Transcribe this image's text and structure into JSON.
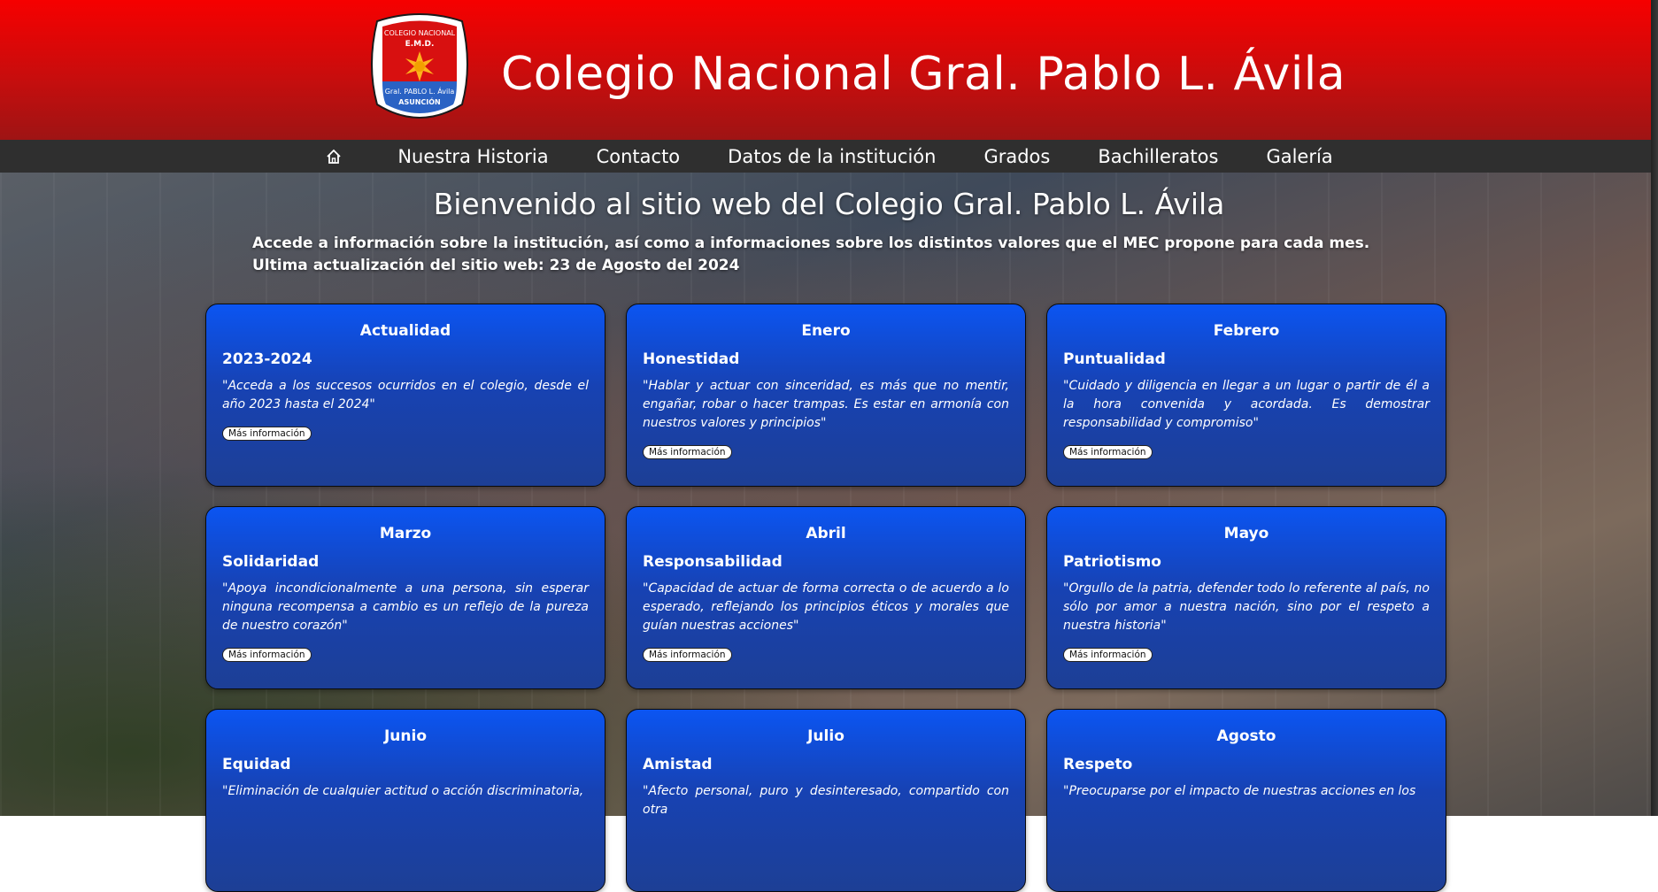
{
  "header": {
    "title": "Colegio Nacional Gral. Pablo L. Ávila",
    "logo": {
      "line1": "COLEGIO NACIONAL",
      "line2": "E.M.D.",
      "line3": "Gral. PABLO L. Ávila",
      "line4": "ASUNCIÓN"
    }
  },
  "nav": {
    "home_icon": "home-icon",
    "items": [
      "Nuestra Historia",
      "Contacto",
      "Datos de la institución",
      "Grados",
      "Bachilleratos",
      "Galería"
    ]
  },
  "main": {
    "welcome": "Bienvenido al sitio web del Colegio Gral. Pablo L. Ávila",
    "intro": "Accede a información sobre la institución, así como a informaciones sobre los distintos valores que el MEC propone para cada mes. Ultima actualización del sitio web: 23 de Agosto del 2024"
  },
  "cards": [
    {
      "title": "Actualidad",
      "value": "2023-2024",
      "desc": "\"Acceda a los succesos ocurridos en el colegio, desde el año 2023 hasta el 2024\"",
      "button": "Más información"
    },
    {
      "title": "Enero",
      "value": "Honestidad",
      "desc": "\"Hablar y actuar con sinceridad, es más que no mentir, engañar, robar o hacer trampas. Es estar en armonía con nuestros valores y principios\"",
      "button": "Más información"
    },
    {
      "title": "Febrero",
      "value": "Puntualidad",
      "desc": "\"Cuidado y diligencia en llegar a un lugar o partir de él a la hora convenida y acordada. Es demostrar responsabilidad y compromiso\"",
      "button": "Más información"
    },
    {
      "title": "Marzo",
      "value": "Solidaridad",
      "desc": "\"Apoya incondicionalmente a una persona, sin esperar ninguna recompensa a cambio es un reflejo de la pureza de nuestro corazón\"",
      "button": "Más información"
    },
    {
      "title": "Abril",
      "value": "Responsabilidad",
      "desc": "\"Capacidad de actuar de forma correcta o de acuerdo a lo esperado, reflejando los principios éticos y morales que guían nuestras acciones\"",
      "button": "Más información"
    },
    {
      "title": "Mayo",
      "value": "Patriotismo",
      "desc": "\"Orgullo de la patria, defender todo lo referente al país, no sólo por amor a nuestra nación, sino por el respeto a nuestra historia\"",
      "button": "Más información"
    },
    {
      "title": "Junio",
      "value": "Equidad",
      "desc": "\"Eliminación de cualquier actitud o acción discriminatoria,",
      "button": ""
    },
    {
      "title": "Julio",
      "value": "Amistad",
      "desc": "\"Afecto personal, puro y desinteresado, compartido con otra",
      "button": ""
    },
    {
      "title": "Agosto",
      "value": "Respeto",
      "desc": "\"Preocuparse por el impacto de nuestras acciones en los",
      "button": ""
    }
  ],
  "colors": {
    "header_top": "#f60000",
    "header_bottom": "#9e1414",
    "nav_bg": "#2f2f2f",
    "card_top": "#0b55f2",
    "card_bottom": "#1d3f95"
  }
}
